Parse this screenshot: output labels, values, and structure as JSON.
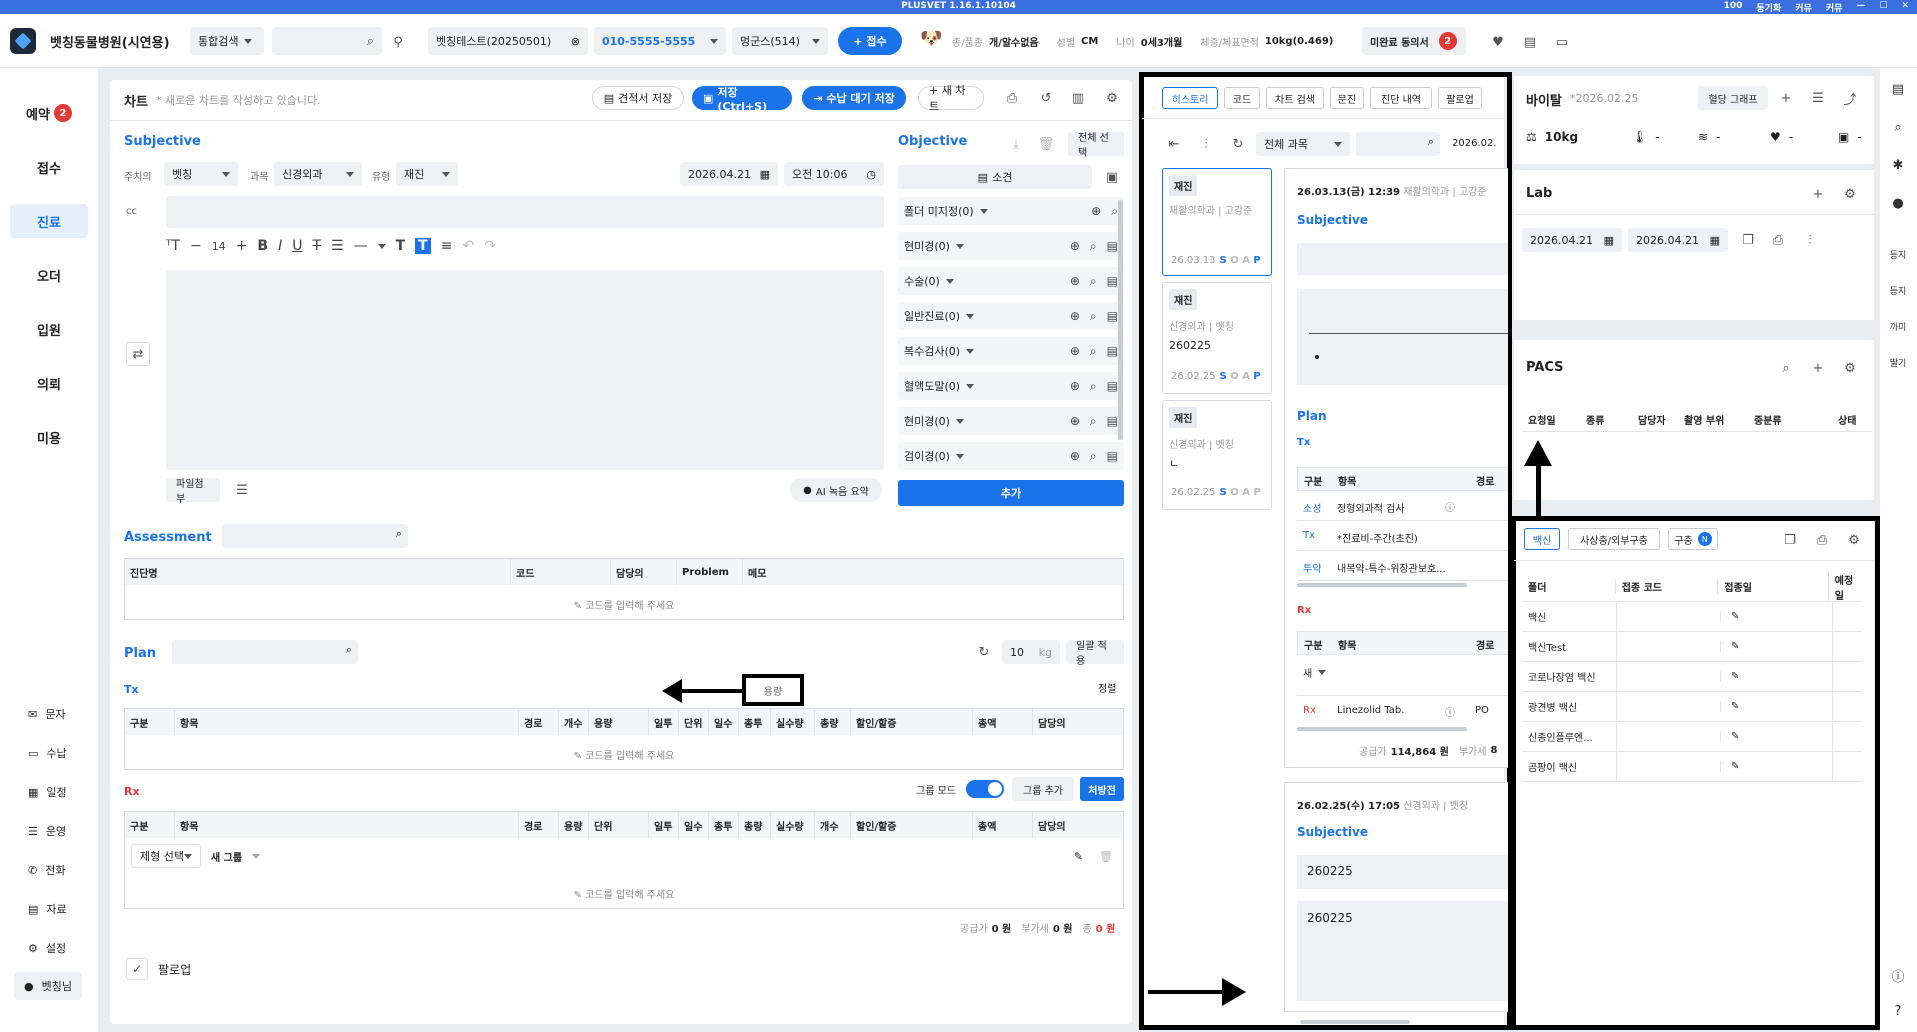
{
  "titlebar": {
    "title": "PLUSVET 1.16.1.10104",
    "zoom": "100",
    "sync": "동기화",
    "notify": "커뮤",
    "call": "커뮤"
  },
  "topbar": {
    "hospital": "벳칭동물병원(시연용)",
    "search_type": "통합검색",
    "patient": "벳칭테스트(20250501)",
    "phone": "010-5555-5555",
    "pet": "멍군스(514)",
    "reception": "+ 접수",
    "species_label": "종/품종",
    "species": "개/알수없음",
    "sex_label": "성별",
    "sex": "CM",
    "age_label": "나이",
    "age": "0세3개월",
    "weight_label": "체중/체표면적",
    "weight": "10kg(0.469)",
    "consent": "미완료 동의서",
    "consent_count": "2"
  },
  "sidebar": {
    "items": [
      {
        "label": "예약",
        "badge": "2"
      },
      {
        "label": "접수"
      },
      {
        "label": "진료"
      },
      {
        "label": "오더"
      },
      {
        "label": "입원"
      },
      {
        "label": "의뢰"
      },
      {
        "label": "미용"
      }
    ],
    "bottom": [
      "문자",
      "수납",
      "일정",
      "운영",
      "전화",
      "자료",
      "설정",
      "벳칭님"
    ]
  },
  "chart": {
    "title": "차트",
    "subtitle": "* 새로운 차트를 작성하고 있습니다.",
    "btn_estimate": "견적서 저장",
    "btn_save": "저장(Ctrl+S)",
    "btn_wait": "수납 대기 저장",
    "btn_new": "+ 새 차트"
  },
  "subjective": {
    "title": "Subjective",
    "doctor_label": "주치의",
    "doctor": "벳칭",
    "dept_label": "과목",
    "dept": "신경외과",
    "type_label": "유형",
    "type": "재진",
    "date": "2026.04.21",
    "time": "오전 10:06",
    "cc": "cc",
    "font_size": "14",
    "attach": "파일첨부",
    "ai_summary": "AI 녹음 요약"
  },
  "objective": {
    "title": "Objective",
    "select_all": "전체 선택",
    "findings": "소견",
    "rows": [
      "폴더 미지정(0)",
      "현미경(0)",
      "수술(0)",
      "일반진료(0)",
      "복수검사(0)",
      "혈액도말(0)",
      "현미경(0)",
      "검이경(0)"
    ],
    "add": "추가"
  },
  "assessment": {
    "title": "Assessment",
    "cols": [
      "진단명",
      "코드",
      "담당의",
      "Problem",
      "메모"
    ],
    "empty": "코드를 입력해 주세요"
  },
  "plan": {
    "title": "Plan",
    "qty": "10",
    "unit": "kg",
    "apply": "일괄 적용",
    "tx": "Tx",
    "sort": "정렬",
    "tooltip": "용량",
    "tx_cols": [
      "구분",
      "항목",
      "경로",
      "개수",
      "용량",
      "일투",
      "단위",
      "일수",
      "총투",
      "실수량",
      "총량",
      "할인/할증",
      "총액",
      "담당의"
    ],
    "empty": "코드를 입력해 주세요",
    "rx": "Rx",
    "group_mode": "그룹 모드",
    "group_add": "그룹 추가",
    "prescription": "처방전",
    "rx_cols": [
      "구분",
      "항목",
      "경로",
      "용량",
      "단위",
      "일투",
      "일수",
      "총투",
      "총량",
      "실수량",
      "개수",
      "할인/할증",
      "총액",
      "담당의"
    ],
    "form_select": "제형 선택",
    "new_group": "새 그룹",
    "supply_label": "공급가",
    "supply": "0 원",
    "vat_label": "부가세",
    "vat": "0 원",
    "total_label": "총",
    "total": "0 원",
    "followup": "팔로업"
  },
  "history": {
    "tabs": [
      "히스토리",
      "코드",
      "차트 검색",
      "문진",
      "진단 내역",
      "팔로업"
    ],
    "filter": "전체 과목",
    "date": "2026.02.",
    "cards": [
      {
        "tag": "재진",
        "dept": "재활의학과 | 고강준",
        "note": "",
        "date": "26.03.13"
      },
      {
        "tag": "재진",
        "dept": "신경외과 | 벳칭",
        "note": "260225",
        "date": "26.02.25"
      },
      {
        "tag": "재진",
        "dept": "신경외과 | 벳칭",
        "note": "ㄴ",
        "date": "26.02.25"
      }
    ],
    "detail1": {
      "date": "26.03.13(금) 12:39",
      "dept": "재활의학과 | 고강준",
      "subjective": "Subjective",
      "plan": "Plan",
      "tx": "Tx",
      "cols": [
        "구분",
        "항목",
        "경로"
      ],
      "rows": [
        {
          "k": "소성",
          "v": "정형외과적 검사"
        },
        {
          "k": "Tx",
          "v": "*진료비-주간(초진)"
        },
        {
          "k": "투약",
          "v": "내복약-특수-위장관보호..."
        }
      ],
      "rx": "Rx",
      "new": "새",
      "rx_row": {
        "k": "Rx",
        "v": "Linezolid Tab.",
        "r": "PO"
      },
      "supply_label": "공급가",
      "supply": "114,864 원",
      "vat_label": "부가세",
      "vat": "8"
    },
    "detail2": {
      "date": "26.02.25(수) 17:05",
      "dept": "신경외과 | 벳칭",
      "subjective": "Subjective",
      "s1": "260225",
      "s2": "260225"
    }
  },
  "vital": {
    "title": "바이탈",
    "date": "*2026.02.25",
    "graph": "혈당 그래프",
    "weight": "10kg",
    "temp": "-",
    "resp": "-",
    "hr": "-",
    "other": "-"
  },
  "lab": {
    "title": "Lab",
    "from": "2026.04.21",
    "to": "2026.04.21"
  },
  "pacs": {
    "title": "PACS",
    "cols": [
      "요청일",
      "종류",
      "담당자",
      "촬영 부위",
      "중분류",
      "상태"
    ]
  },
  "vaccine": {
    "tabs": [
      "백신",
      "사상충/외부구충",
      "구충"
    ],
    "new_badge": "N",
    "cols": [
      "폴더",
      "접종 코드",
      "접종일",
      "예정일"
    ],
    "rows": [
      "백신",
      "백신Test",
      "코로나장염 백신",
      "광견병 백신",
      "신종인플루엔...",
      "곰팡이 백신"
    ]
  },
  "right_sidebar": [
    "등지",
    "등지",
    "까미",
    "딸기"
  ]
}
